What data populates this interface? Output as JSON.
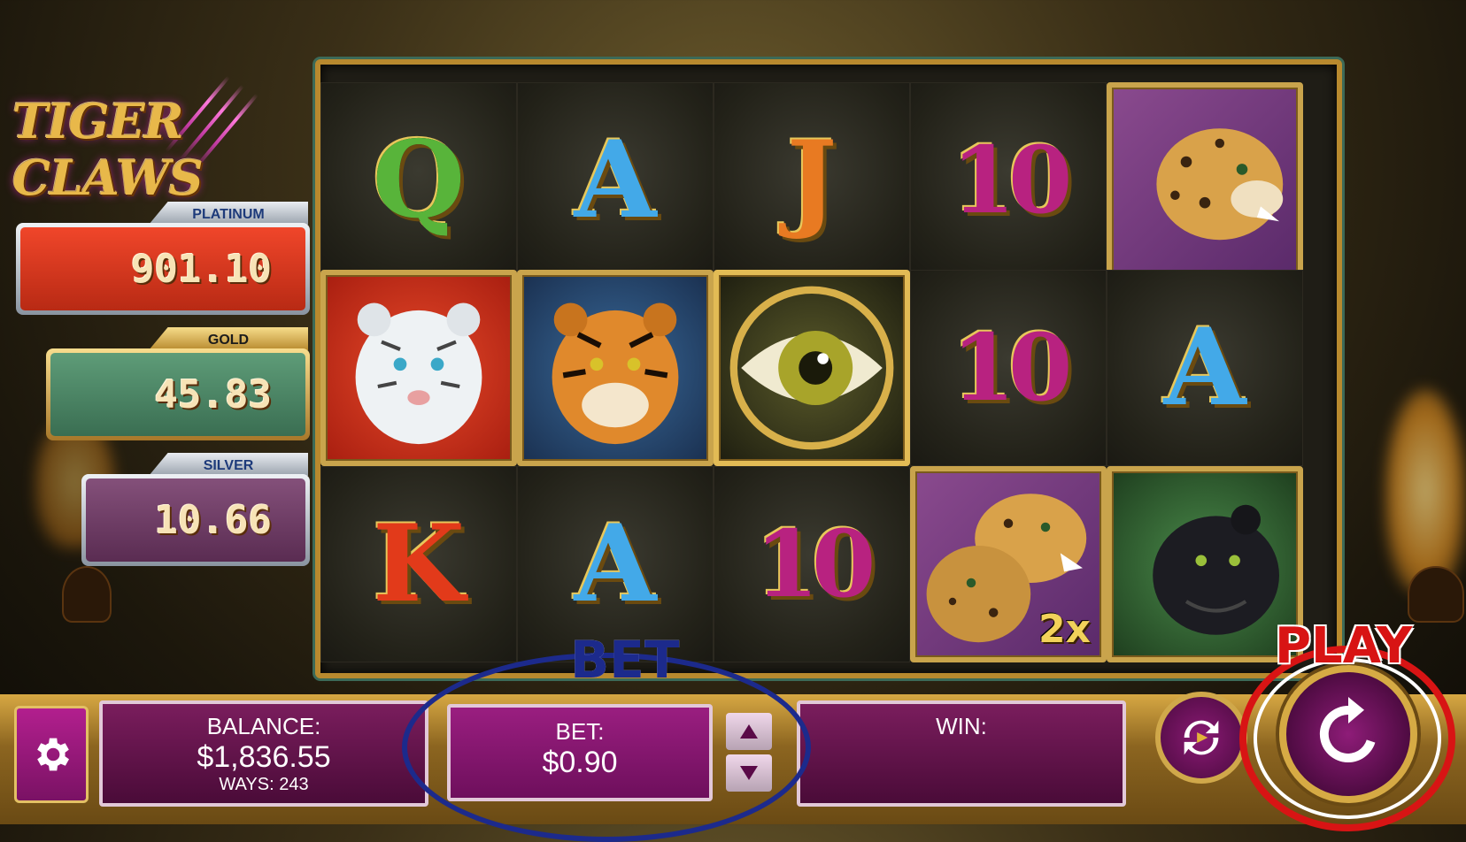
{
  "logo": {
    "text": "TIGER CLAWS"
  },
  "jackpots": [
    {
      "name": "PLATINUM",
      "value": "901.10",
      "color": "#d8341c"
    },
    {
      "name": "GOLD",
      "value": "45.83",
      "color": "#4e8a68"
    },
    {
      "name": "SILVER",
      "value": "10.66",
      "color": "#6a3a5c"
    }
  ],
  "reels": {
    "row1": [
      "Q",
      "A",
      "J",
      "10",
      "leopard"
    ],
    "row2": [
      "white-tiger",
      "tiger",
      "tiger-eye",
      "10",
      "A"
    ],
    "row3": [
      "K",
      "A",
      "10",
      "leopards-2x",
      "black-panther"
    ],
    "multiplier": "2x"
  },
  "bottom": {
    "balance_label": "BALANCE:",
    "balance_value": "$1,836.55",
    "ways_label": "WAYS: 243",
    "bet_label": "BET:",
    "bet_value": "$0.90",
    "win_label": "WIN:",
    "win_value": ""
  },
  "annotations": {
    "bet": "BET",
    "play": "PLAY",
    "bet_color": "#1c2a8c",
    "play_color": "#d81414"
  }
}
